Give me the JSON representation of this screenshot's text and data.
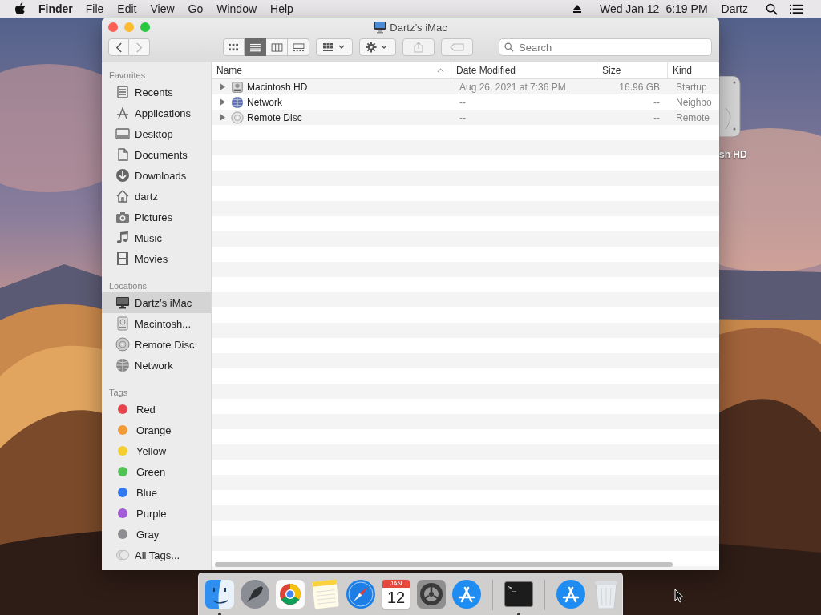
{
  "menu_bar": {
    "app_name": "Finder",
    "menus": [
      "File",
      "Edit",
      "View",
      "Go",
      "Window",
      "Help"
    ],
    "date": "Wed Jan 12",
    "time": "6:19 PM",
    "user": "Dartz"
  },
  "desktop_icons": [
    {
      "label": "sh HD"
    }
  ],
  "window": {
    "title": "Dartz’s iMac",
    "toolbar": {
      "nav": [
        {
          "kind": "back",
          "disabled": false
        },
        {
          "kind": "forward",
          "disabled": true
        }
      ],
      "views": [
        {
          "kind": "icons",
          "selected": false
        },
        {
          "kind": "list",
          "selected": true
        },
        {
          "kind": "columns",
          "selected": false
        },
        {
          "kind": "gallery",
          "selected": false
        }
      ],
      "actions": [
        {
          "kind": "group",
          "disabled": false
        },
        {
          "kind": "action",
          "disabled": false
        },
        {
          "kind": "share",
          "disabled": true
        },
        {
          "kind": "tags",
          "disabled": true
        }
      ],
      "search": {
        "placeholder": "Search"
      }
    },
    "sidebar": {
      "sections": [
        {
          "title": "Favorites",
          "items": [
            {
              "label": "Recents",
              "kind": "recents",
              "selected": false
            },
            {
              "label": "Applications",
              "kind": "applications",
              "selected": false
            },
            {
              "label": "Desktop",
              "kind": "desktop",
              "selected": false
            },
            {
              "label": "Documents",
              "kind": "documents",
              "selected": false
            },
            {
              "label": "Downloads",
              "kind": "downloads",
              "selected": false
            },
            {
              "label": "dartz",
              "kind": "home",
              "selected": false
            },
            {
              "label": "Pictures",
              "kind": "pictures",
              "selected": false
            },
            {
              "label": "Music",
              "kind": "music",
              "selected": false
            },
            {
              "label": "Movies",
              "kind": "movies",
              "selected": false
            }
          ]
        },
        {
          "title": "Locations",
          "items": [
            {
              "label": "Dartz’s iMac",
              "kind": "computer",
              "selected": true
            },
            {
              "label": "Macintosh...",
              "kind": "disk",
              "selected": false
            },
            {
              "label": "Remote Disc",
              "kind": "disc",
              "selected": false
            },
            {
              "label": "Network",
              "kind": "network",
              "selected": false
            }
          ]
        },
        {
          "title": "Tags",
          "items": [
            {
              "label": "Red",
              "kind": "tag",
              "color": "#e8434b",
              "selected": false
            },
            {
              "label": "Orange",
              "kind": "tag",
              "color": "#f29a35",
              "selected": false
            },
            {
              "label": "Yellow",
              "kind": "tag",
              "color": "#f2cf2f",
              "selected": false
            },
            {
              "label": "Green",
              "kind": "tag",
              "color": "#4fc454",
              "selected": false
            },
            {
              "label": "Blue",
              "kind": "tag",
              "color": "#3478f0",
              "selected": false
            },
            {
              "label": "Purple",
              "kind": "tag",
              "color": "#a25ad6",
              "selected": false
            },
            {
              "label": "Gray",
              "kind": "tag",
              "color": "#8e8e92",
              "selected": false
            },
            {
              "label": "All Tags...",
              "kind": "all_tags",
              "selected": false
            }
          ]
        }
      ]
    },
    "table": {
      "columns": [
        {
          "label": "Name",
          "sorted": true
        },
        {
          "label": "Date Modified",
          "sorted": false
        },
        {
          "label": "Size",
          "sorted": false
        },
        {
          "label": "Kind",
          "sorted": false
        }
      ],
      "rows": [
        {
          "kind": "disk",
          "name": "Macintosh HD",
          "date": "Aug 26, 2021 at 7:36 PM",
          "size": "16.96 GB",
          "type": "Startup",
          "expanded": false
        },
        {
          "kind": "network",
          "name": "Network",
          "date": "--",
          "size": "--",
          "type": "Neighbo",
          "expanded": false
        },
        {
          "kind": "disc",
          "name": "Remote Disc",
          "date": "--",
          "size": "--",
          "type": "Remote",
          "expanded": false
        }
      ]
    }
  },
  "dock": {
    "items": [
      {
        "kind": "finder",
        "running": true
      },
      {
        "kind": "rocket",
        "running": false
      },
      {
        "kind": "browser",
        "running": false
      },
      {
        "kind": "notes",
        "running": false
      },
      {
        "kind": "compass",
        "running": false
      },
      {
        "kind": "calendar",
        "month": "JAN",
        "day": "12",
        "running": false
      },
      {
        "kind": "gear",
        "running": false
      },
      {
        "kind": "apps",
        "running": false
      },
      {
        "kind": "separator"
      },
      {
        "kind": "terminal",
        "prompt": ">_",
        "running": true
      },
      {
        "kind": "separator"
      },
      {
        "kind": "apps",
        "running": false
      },
      {
        "kind": "trash",
        "running": false
      }
    ]
  }
}
